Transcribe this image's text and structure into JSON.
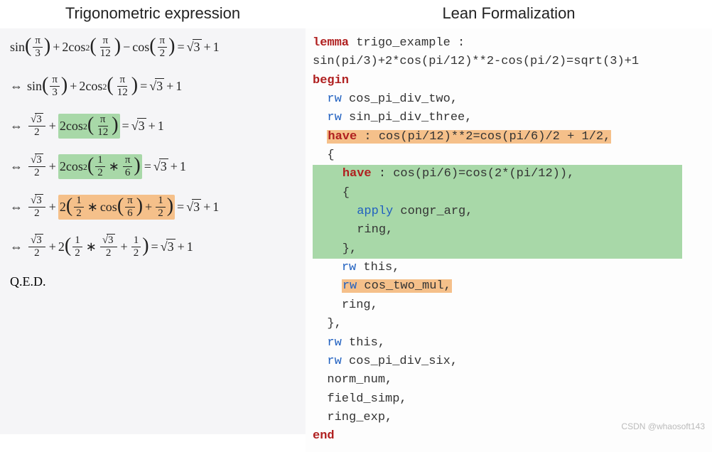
{
  "headings": {
    "left": "Trigonometric expression",
    "right": "Lean Formalization"
  },
  "math": {
    "line1": {
      "sin": "sin",
      "cos2": "cos",
      "cos": "cos",
      "pi": "π",
      "2": "2",
      "3": "3",
      "12": "12",
      "minus": "−",
      "plus": "+",
      "eq": "=",
      "sqrt3": "3",
      "one": "1"
    },
    "line2": {
      "equiv": "⇔",
      "sin": "sin",
      "cos2": "cos",
      "pi": "π",
      "2": "2",
      "3": "3",
      "12": "12",
      "plus": "+",
      "eq": "=",
      "sqrt3": "3",
      "one": "1"
    },
    "line3": {
      "equiv": "⇔",
      "sqrt3": "3",
      "2": "2",
      "cos2": "cos",
      "pi": "π",
      "12": "12",
      "plus": "+",
      "eq": "=",
      "one": "1"
    },
    "line4": {
      "equiv": "⇔",
      "sqrt3": "3",
      "2": "2",
      "cos2": "cos",
      "half": "1",
      "half_den": "2",
      "star": "∗",
      "pi": "π",
      "6": "6",
      "plus": "+",
      "eq": "=",
      "one": "1"
    },
    "line5": {
      "equiv": "⇔",
      "sqrt3": "3",
      "2": "2",
      "half": "1",
      "half_den": "2",
      "star": "∗",
      "cos": "cos",
      "pi": "π",
      "6": "6",
      "plus": "+",
      "eq": "=",
      "one": "1"
    },
    "line6": {
      "equiv": "⇔",
      "sqrt3": "3",
      "2": "2",
      "half": "1",
      "half_den": "2",
      "star": "∗",
      "plus": "+",
      "eq": "=",
      "one": "1"
    },
    "qed": "Q.E.D."
  },
  "code": {
    "l1_kw": "lemma",
    "l1_rest": " trigo_example :",
    "l2": "sin(pi/3)+2*cos(pi/12)**2-cos(pi/2)=sqrt(3)+1",
    "l3_kw": "begin",
    "l4_kw": "rw",
    "l4_rest": " cos_pi_div_two,",
    "l5_kw": "rw",
    "l5_rest": " sin_pi_div_three,",
    "l6_kw": "have",
    "l6_rest": " : cos(pi/12)**2=cos(pi/6)/2 + 1/2,",
    "l7": "  {",
    "l8_pre": "    ",
    "l8_kw": "have",
    "l8_rest": " : cos(pi/6)=cos(2*(pi/12)),",
    "l9": "    {",
    "l10_pre": "      ",
    "l10_kw": "apply",
    "l10_rest": " congr_arg,",
    "l11_pre": "      ",
    "l11_rest": "ring,",
    "l12": "    },",
    "l13_pre": "    ",
    "l13_kw": "rw",
    "l13_rest": " this,",
    "l14_pre": "    ",
    "l14_kw": "rw",
    "l14_rest": " cos_two_mul,",
    "l15_pre": "    ",
    "l15_rest": "ring,",
    "l16": "  },",
    "l17_pre": "  ",
    "l17_kw": "rw",
    "l17_rest": " this,",
    "l18_pre": "  ",
    "l18_kw": "rw",
    "l18_rest": " cos_pi_div_six,",
    "l19": "  norm_num,",
    "l20": "  field_simp,",
    "l21": "  ring_exp,",
    "l22_kw": "end"
  },
  "watermark": "CSDN @whaosoft143"
}
